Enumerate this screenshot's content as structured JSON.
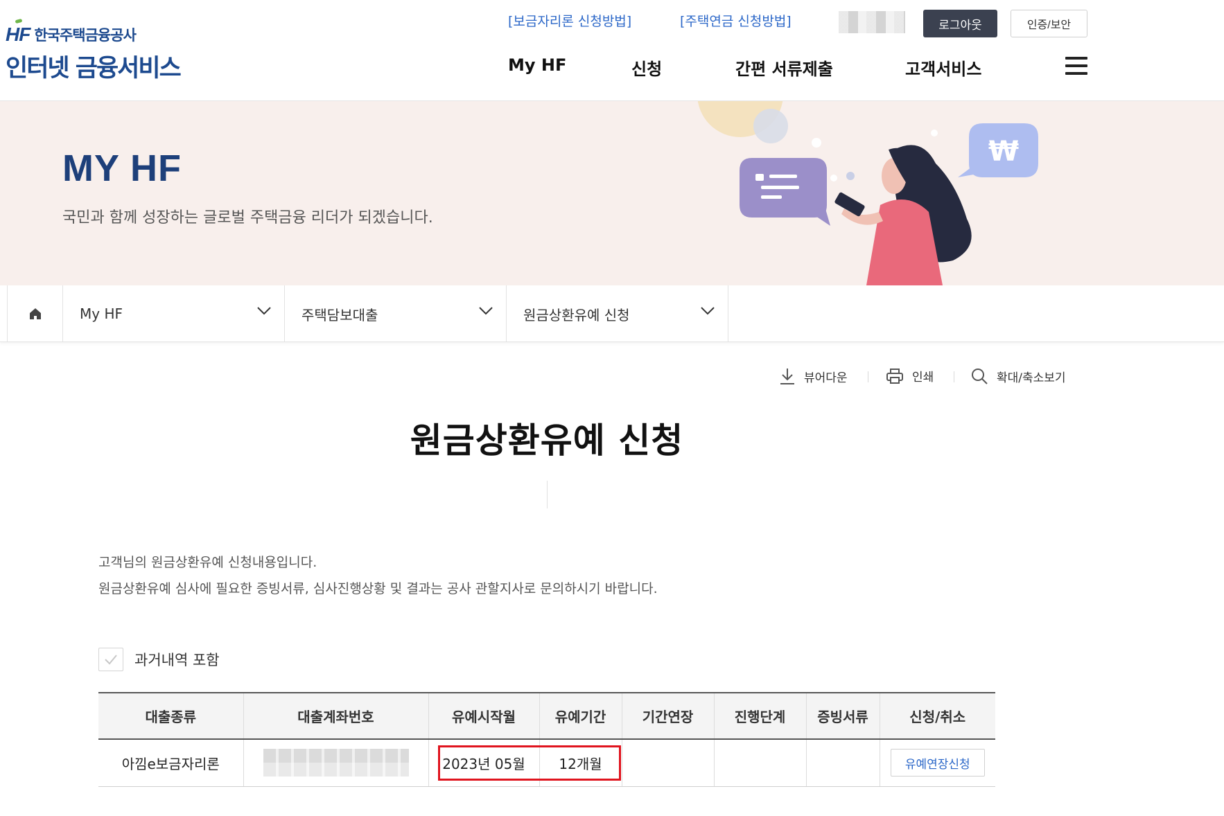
{
  "header": {
    "logo_mark": "HF",
    "logo_org": "한국주택금융공사",
    "logo_service": "인터넷 금융서비스",
    "util_links": [
      "[보금자리론 신청방법]",
      "[주택연금 신청방법]"
    ],
    "logout_label": "로그아웃",
    "cert_label": "인증/보안",
    "gnb": [
      "My HF",
      "신청",
      "간편 서류제출",
      "고객서비스"
    ]
  },
  "banner": {
    "title": "MY HF",
    "subtitle": "국민과 함께 성장하는 글로벌 주택금융 리더가 되겠습니다."
  },
  "location": {
    "items": [
      "My HF",
      "주택담보대출",
      "원금상환유예 신청"
    ]
  },
  "tools": {
    "download": "뷰어다운",
    "print": "인쇄",
    "zoom": "확대/축소보기"
  },
  "page": {
    "title": "원금상환유예 신청",
    "desc1": "고객님의 원금상환유예 신청내용입니다.",
    "desc2": "원금상환유예 심사에 필요한 증빙서류, 심사진행상황 및 결과는 공사 관할지사로 문의하시기 바랍니다.",
    "include_past_label": "과거내역 포함"
  },
  "table": {
    "headers": [
      "대출종류",
      "대출계좌번호",
      "유예시작월",
      "유예기간",
      "기간연장",
      "진행단계",
      "증빙서류",
      "신청/취소"
    ],
    "rows": [
      {
        "loan_type": "아낌e보금자리론",
        "start_month": "2023년 05월",
        "period": "12개월",
        "extension": "",
        "stage": "",
        "documents": "",
        "action_label": "유예연장신청"
      }
    ]
  },
  "colors": {
    "brand": "#1d4a8f",
    "link": "#2b67c8",
    "banner_bg": "#f8efec",
    "highlight": "#e0141e"
  }
}
